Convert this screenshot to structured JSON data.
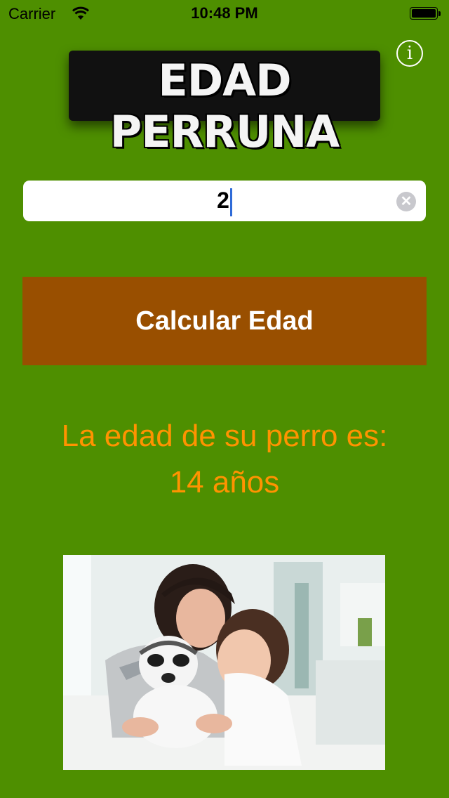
{
  "status_bar": {
    "carrier": "Carrier",
    "time": "10:48 PM"
  },
  "app": {
    "logo_text": "EDAD PERRUNA",
    "info_icon": "info-icon",
    "info_glyph": "i"
  },
  "form": {
    "age_value": "2",
    "clear_icon": "clear-icon",
    "clear_glyph": "✕",
    "button_label": "Calcular Edad"
  },
  "result": {
    "label": "La edad de su perro es:",
    "value": "14 años"
  },
  "colors": {
    "background": "#4e8f00",
    "button": "#994f00",
    "result_text": "#ff9300"
  }
}
